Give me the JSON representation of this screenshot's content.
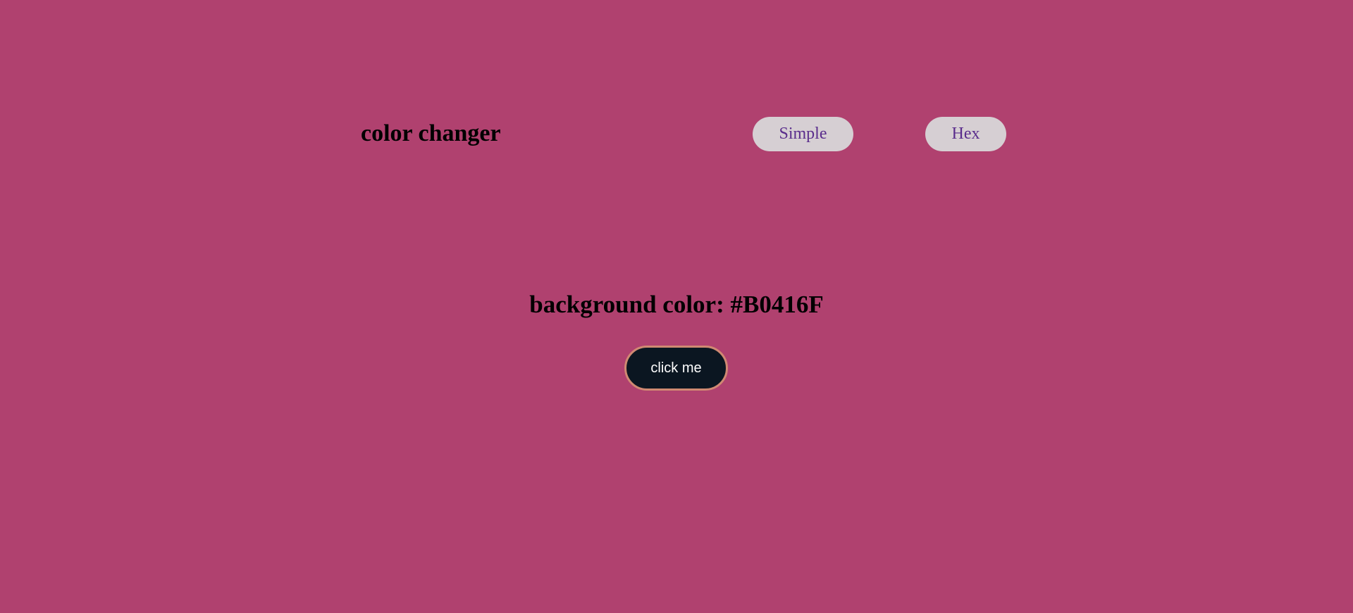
{
  "header": {
    "brand": "color changer",
    "nav": {
      "simple_label": "Simple",
      "hex_label": "Hex"
    }
  },
  "main": {
    "heading_prefix": "background color: ",
    "color_value": "#B0416F",
    "button_label": "click me"
  },
  "colors": {
    "page_background": "#B0416F",
    "nav_button_background": "#D6CFD3",
    "nav_button_text": "#5A2D8C",
    "action_button_background": "#0B1621",
    "action_button_border": "#D08972",
    "action_button_text": "#FFFFFF"
  }
}
